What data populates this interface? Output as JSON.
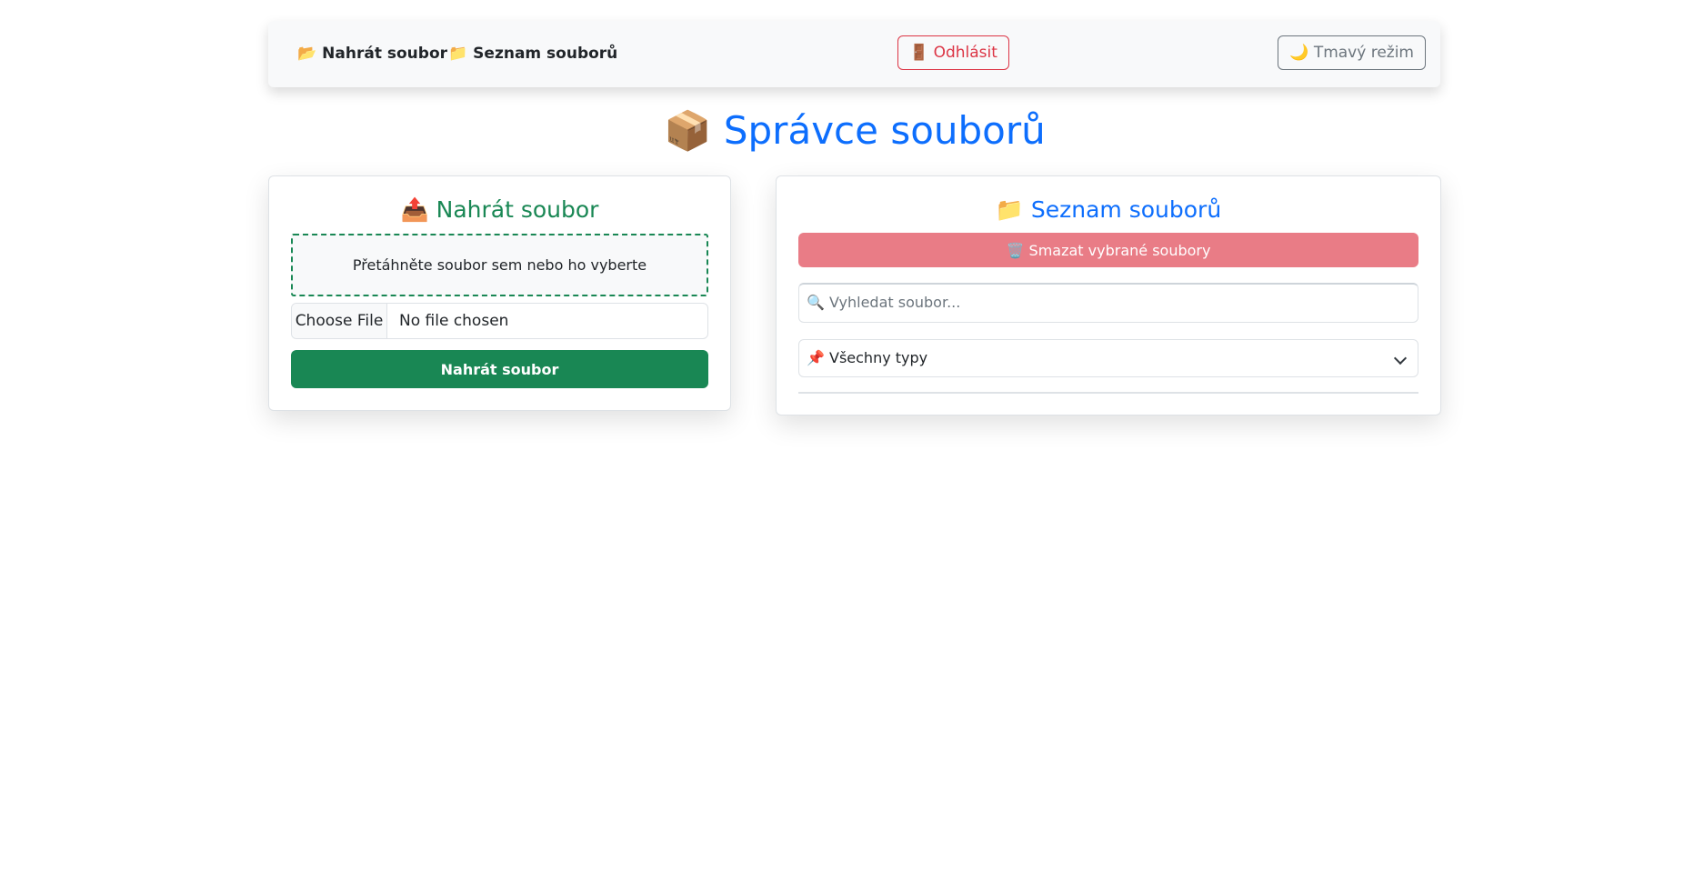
{
  "navbar": {
    "upload_icon": "📂",
    "upload_label": "Nahrát soubor",
    "list_icon": "📁",
    "list_label": "Seznam souborů",
    "logout_label": "🚪 Odhlásit",
    "dark_mode_label": "🌙 Tmavý režim"
  },
  "page": {
    "title": "📦 Správce souborů"
  },
  "upload_card": {
    "title": "📤 Nahrát soubor",
    "dropzone_text": "Přetáhněte soubor sem nebo ho vyberte",
    "choose_file_label": "Choose File",
    "no_file_label": "No file chosen",
    "submit_label": "Nahrát soubor"
  },
  "list_card": {
    "title": "📁 Seznam souborů",
    "delete_selected_label": "🗑️ Smazat vybrané soubory",
    "search_placeholder": "🔍 Vyhledat soubor...",
    "type_filter_selected": "📌 Všechny typy"
  },
  "colors": {
    "primary": "#0d6efd",
    "success": "#198754",
    "danger": "#dc3545",
    "danger_light": "#e97c86",
    "secondary": "#6c757d"
  }
}
